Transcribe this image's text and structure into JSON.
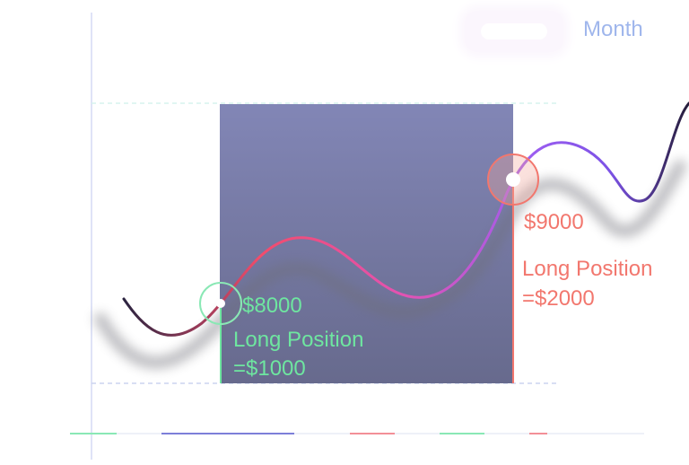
{
  "chart_data": {
    "type": "line",
    "title": "",
    "xlabel": "Month",
    "ylabel": "",
    "legend": "Month",
    "grid": false,
    "highlight_region": {
      "type": "band",
      "color": "#6d6e99"
    },
    "annotations": [
      {
        "name": "entry",
        "price": "$8000",
        "text_line1": "Long Position",
        "text_line2": "=$1000",
        "color": "#6ee6a0"
      },
      {
        "name": "exit",
        "price": "$9000",
        "text_line1": "Long Position",
        "text_line2": "=$2000",
        "color": "#f2776e"
      }
    ],
    "axis_colors": {
      "left_axis": "#dfe3f7",
      "bottom_segments": [
        "#8ae8b5",
        "#7d7fd9",
        "#f38f97",
        "#8ae8b5",
        "#f38f97"
      ]
    },
    "line_gradient": [
      "#2b2440",
      "#f24c6b",
      "#e253b4",
      "#9c5df0",
      "#7c52e6",
      "#241c38"
    ]
  }
}
